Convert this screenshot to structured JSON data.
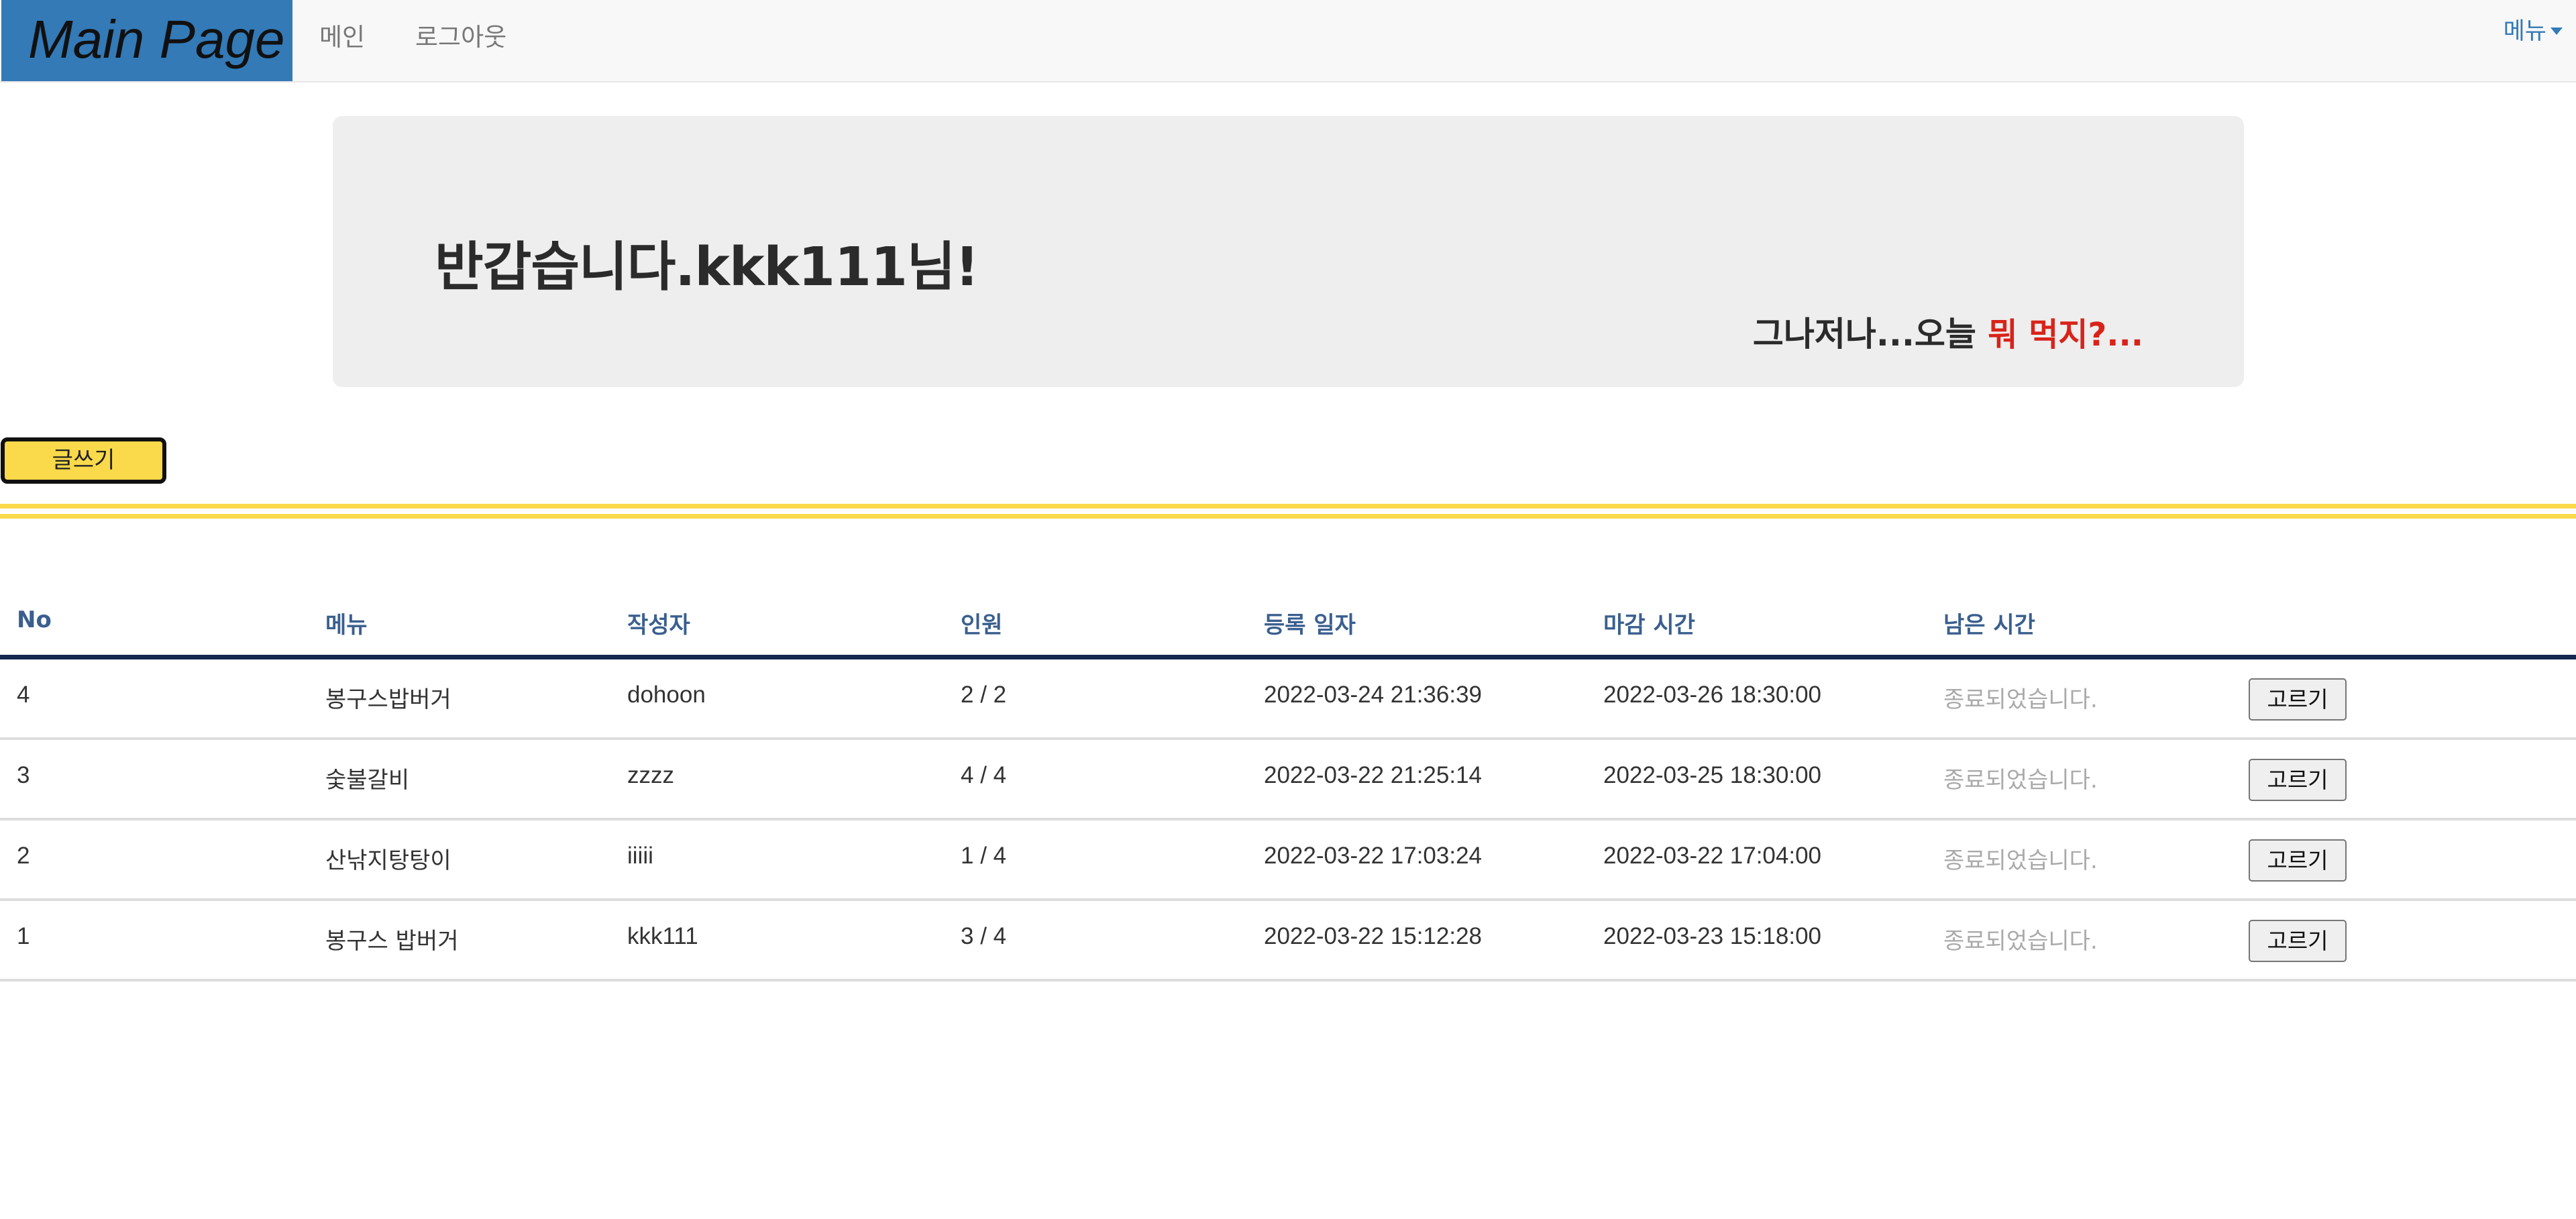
{
  "navbar": {
    "brand": "Main Page",
    "links": [
      "메인",
      "로그아웃"
    ],
    "menu": "메뉴"
  },
  "jumbotron": {
    "greeting": "반갑습니다.kkk111님!",
    "tagline_prefix": "그나저나...오늘 ",
    "tagline_accent": "뭐 먹지?..."
  },
  "write_button": "글쓰기",
  "table": {
    "headers": [
      "No",
      "메뉴",
      "작성자",
      "인원",
      "등록 일자",
      "마감 시간",
      "남은 시간"
    ],
    "rows": [
      {
        "no": "4",
        "menu": "봉구스밥버거",
        "writer": "dohoon",
        "people": "2 / 2",
        "registered": "2022-03-24 21:36:39",
        "deadline": "2022-03-26 18:30:00",
        "remaining": "종료되었습니다.",
        "action": "고르기"
      },
      {
        "no": "3",
        "menu": "숯불갈비",
        "writer": "zzzz",
        "people": "4 / 4",
        "registered": "2022-03-22 21:25:14",
        "deadline": "2022-03-25 18:30:00",
        "remaining": "종료되었습니다.",
        "action": "고르기"
      },
      {
        "no": "2",
        "menu": "산낚지탕탕이",
        "writer": "iiiii",
        "people": "1 / 4",
        "registered": "2022-03-22 17:03:24",
        "deadline": "2022-03-22 17:04:00",
        "remaining": "종료되었습니다.",
        "action": "고르기"
      },
      {
        "no": "1",
        "menu": "봉구스 밥버거",
        "writer": "kkk111",
        "people": "3 / 4",
        "registered": "2022-03-22 15:12:28",
        "deadline": "2022-03-23 15:18:00",
        "remaining": "종료되었습니다.",
        "action": "고르기"
      }
    ]
  },
  "colors": {
    "brand_bg": "#337ab7",
    "accent_yellow": "#fad94b",
    "accent_red": "#d9231a",
    "header_text": "#3a5f8f",
    "header_rule": "#142850"
  }
}
